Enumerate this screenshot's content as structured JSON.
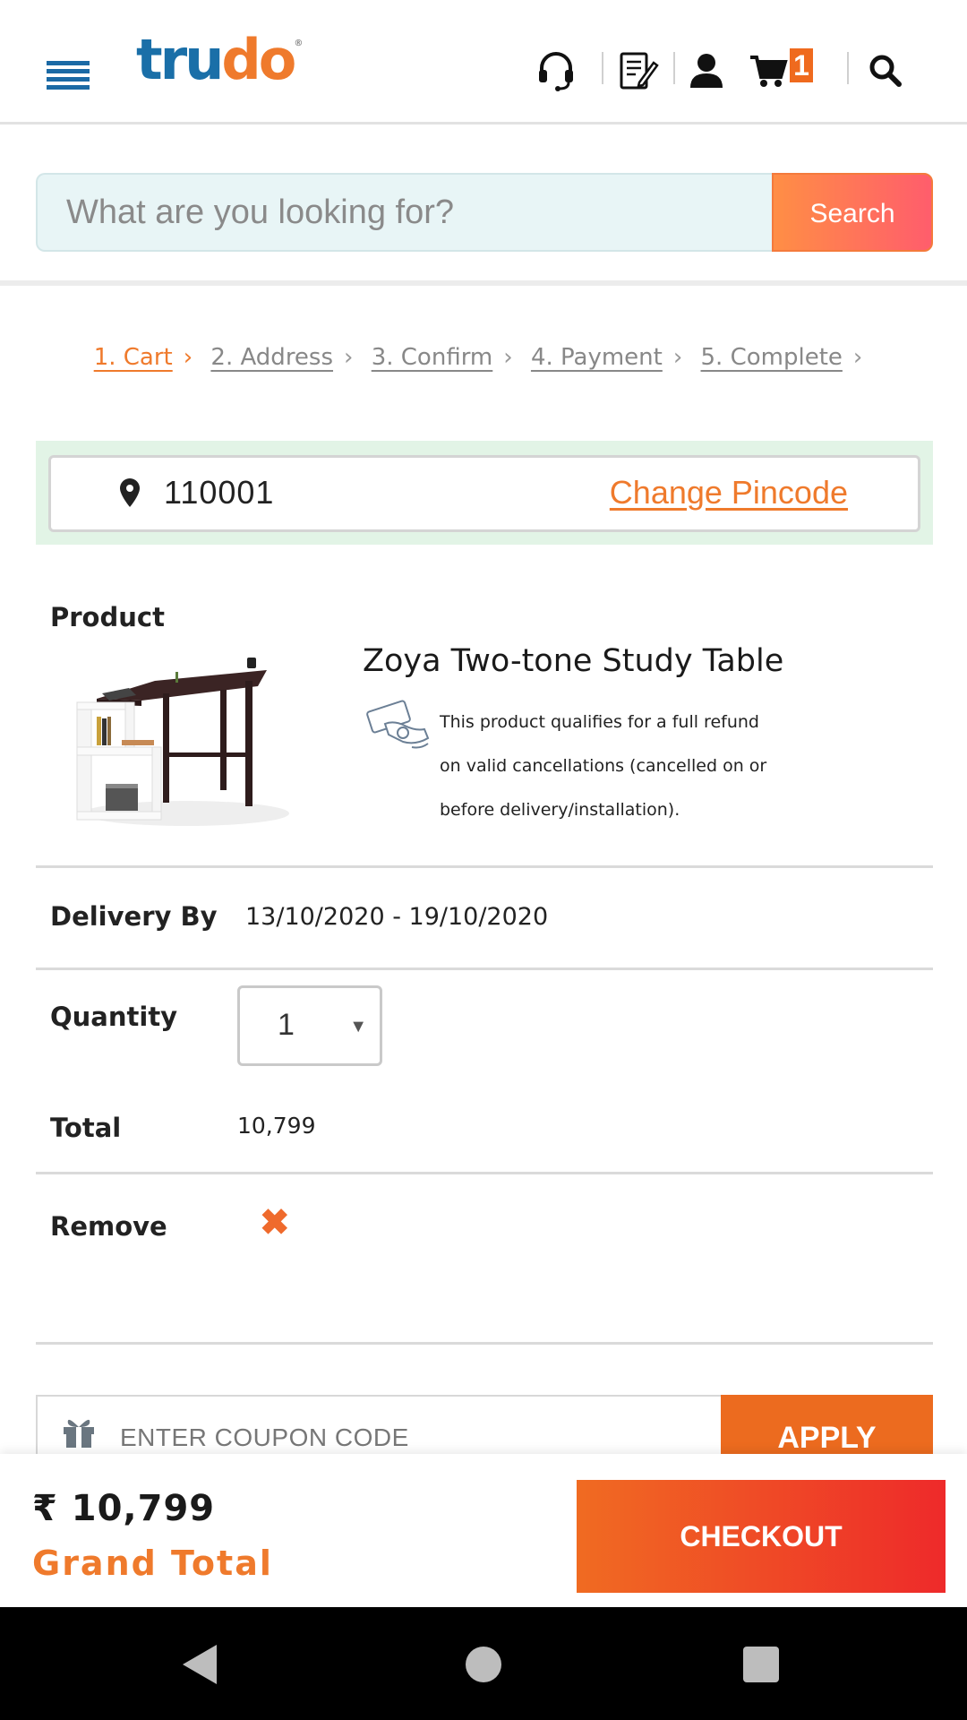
{
  "header": {
    "logo_part1": "tru",
    "logo_part2": "do",
    "logo_reg": "®",
    "cart_count": "1",
    "icons": [
      "menu-icon",
      "headset-icon",
      "notepad-icon",
      "user-icon",
      "cart-icon",
      "search-icon"
    ],
    "brand_colors": {
      "blue": "#1a6fa8",
      "orange": "#ef7a2c"
    }
  },
  "search": {
    "placeholder": "What are you looking for?",
    "button_label": "Search"
  },
  "breadcrumb": {
    "steps": [
      "1. Cart",
      "2. Address",
      "3. Confirm",
      "4. Payment",
      "5. Complete"
    ],
    "active_index": 0
  },
  "pincode": {
    "value": "110001",
    "change_label": "Change Pincode"
  },
  "product": {
    "section_label": "Product",
    "title": "Zoya Two-tone Study Table",
    "refund_lines": [
      "This product qualifies for a full refund",
      "on valid cancellations (cancelled on or",
      "before delivery/installation)."
    ]
  },
  "delivery": {
    "label": "Delivery By",
    "value": "13/10/2020 - 19/10/2020"
  },
  "quantity": {
    "label": "Quantity",
    "value": "1"
  },
  "total": {
    "label": "Total",
    "value": "10,799"
  },
  "remove": {
    "label": "Remove",
    "icon": "close-icon"
  },
  "coupon": {
    "placeholder": "ENTER COUPON CODE",
    "apply_label": "APPLY"
  },
  "footer": {
    "grand_amount": "₹ 10,799",
    "grand_label": "Grand Total",
    "checkout_label": "CHECKOUT"
  }
}
